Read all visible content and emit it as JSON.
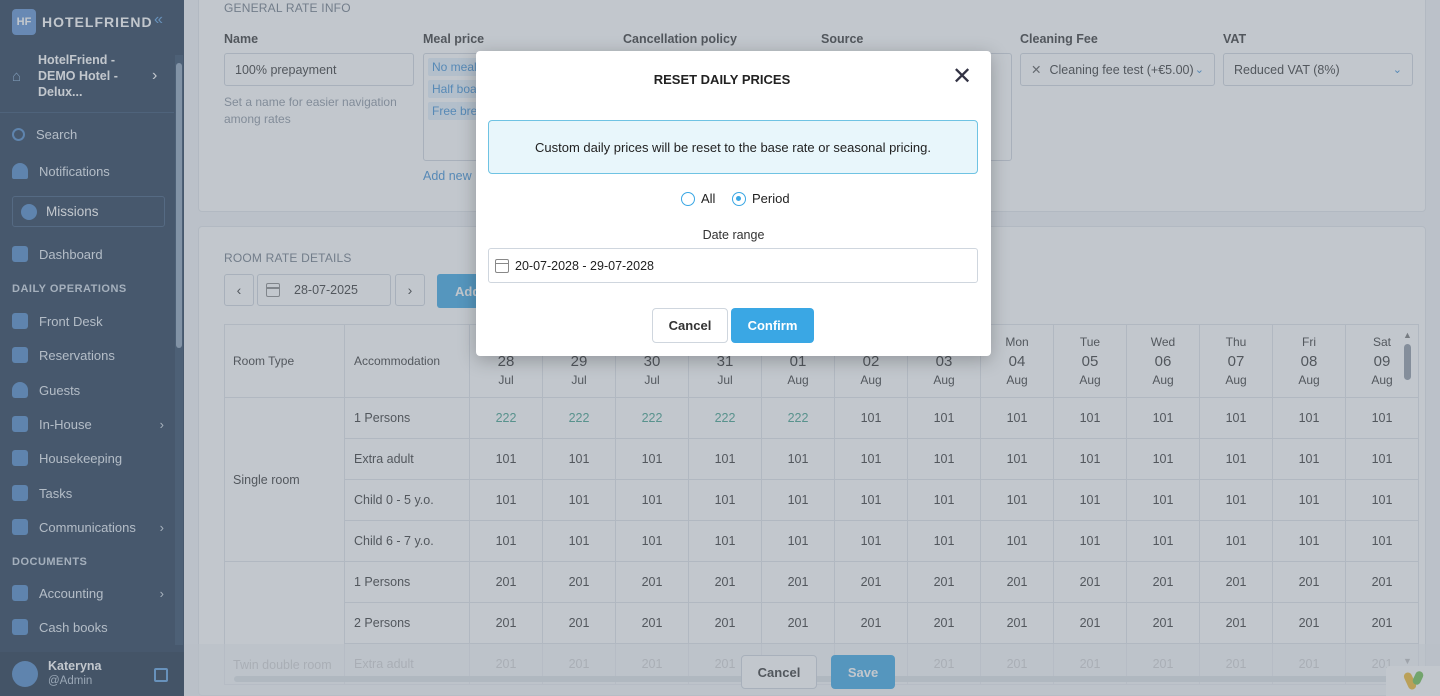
{
  "app": {
    "brand": "HOTELFRIEND",
    "logo_mark": "HF"
  },
  "sidebar": {
    "hotel_name": "HotelFriend - DEMO Hotel - Delux...",
    "search": "Search",
    "notifications": "Notifications",
    "missions": "Missions",
    "dashboard": "Dashboard",
    "section_daily": "DAILY OPERATIONS",
    "front_desk": "Front Desk",
    "reservations": "Reservations",
    "guests": "Guests",
    "in_house": "In-House",
    "housekeeping": "Housekeeping",
    "tasks": "Tasks",
    "communications": "Communications",
    "section_documents": "DOCUMENTS",
    "accounting": "Accounting",
    "cash_books": "Cash books",
    "user_name": "Kateryna",
    "user_role": "@Admin"
  },
  "general": {
    "title": "GENERAL RATE INFO",
    "name_label": "Name",
    "name_value": "100% prepayment",
    "name_hint": "Set a name for easier navigation among rates",
    "meal_label": "Meal price",
    "meal_tags": [
      "No meal",
      "Half boa",
      "Free bre"
    ],
    "add_new": "Add new",
    "cancellation_label": "Cancellation policy",
    "source_label": "Source",
    "cleaning_label": "Cleaning Fee",
    "cleaning_value": "Cleaning fee test (+€5.00)",
    "vat_label": "VAT",
    "vat_value": "Reduced VAT (8%)"
  },
  "room_rates": {
    "title": "ROOM RATE DETAILS",
    "date": "28-07-2025",
    "add_label": "Add",
    "col_room_type": "Room Type",
    "col_accommodation": "Accommodation",
    "days": [
      {
        "dow": "",
        "day": "28",
        "mon": "Jul"
      },
      {
        "dow": "",
        "day": "29",
        "mon": "Jul"
      },
      {
        "dow": "",
        "day": "30",
        "mon": "Jul"
      },
      {
        "dow": "",
        "day": "31",
        "mon": "Jul"
      },
      {
        "dow": "",
        "day": "01",
        "mon": "Aug"
      },
      {
        "dow": "",
        "day": "02",
        "mon": "Aug"
      },
      {
        "dow": "",
        "day": "03",
        "mon": "Aug"
      },
      {
        "dow": "Mon",
        "day": "04",
        "mon": "Aug"
      },
      {
        "dow": "Tue",
        "day": "05",
        "mon": "Aug"
      },
      {
        "dow": "Wed",
        "day": "06",
        "mon": "Aug"
      },
      {
        "dow": "Thu",
        "day": "07",
        "mon": "Aug"
      },
      {
        "dow": "Fri",
        "day": "08",
        "mon": "Aug"
      },
      {
        "dow": "Sat",
        "day": "09",
        "mon": "Aug"
      }
    ],
    "rows": [
      {
        "room": "Single room",
        "acc": "1 Persons",
        "values": [
          "222",
          "222",
          "222",
          "222",
          "222",
          "101",
          "101",
          "101",
          "101",
          "101",
          "101",
          "101",
          "101"
        ]
      },
      {
        "room": "",
        "acc": "Extra adult",
        "values": [
          "101",
          "101",
          "101",
          "101",
          "101",
          "101",
          "101",
          "101",
          "101",
          "101",
          "101",
          "101",
          "101"
        ]
      },
      {
        "room": "",
        "acc": "Child 0 - 5 y.o.",
        "values": [
          "101",
          "101",
          "101",
          "101",
          "101",
          "101",
          "101",
          "101",
          "101",
          "101",
          "101",
          "101",
          "101"
        ]
      },
      {
        "room": "",
        "acc": "Child 6 - 7 y.o.",
        "values": [
          "101",
          "101",
          "101",
          "101",
          "101",
          "101",
          "101",
          "101",
          "101",
          "101",
          "101",
          "101",
          "101"
        ]
      },
      {
        "room": "Twin double room",
        "acc": "1 Persons",
        "values": [
          "201",
          "201",
          "201",
          "201",
          "201",
          "201",
          "201",
          "201",
          "201",
          "201",
          "201",
          "201",
          "201"
        ]
      },
      {
        "room": "",
        "acc": "2 Persons",
        "values": [
          "201",
          "201",
          "201",
          "201",
          "201",
          "201",
          "201",
          "201",
          "201",
          "201",
          "201",
          "201",
          "201"
        ]
      },
      {
        "room": "",
        "acc": "Extra adult",
        "values": [
          "201",
          "201",
          "201",
          "201",
          "201",
          "201",
          "201",
          "201",
          "201",
          "201",
          "201",
          "201",
          "201"
        ]
      }
    ]
  },
  "footer": {
    "cancel": "Cancel",
    "save": "Save"
  },
  "modal": {
    "title": "RESET DAILY PRICES",
    "info": "Custom daily prices will be reset to the base rate or seasonal pricing.",
    "radio_all": "All",
    "radio_period": "Period",
    "selected": "Period",
    "date_label": "Date range",
    "date_value": "20-07-2028 - 29-07-2028",
    "cancel": "Cancel",
    "confirm": "Confirm"
  },
  "colors": {
    "accent": "#3aa7e4",
    "sidebar": "#1f3550",
    "highlight_value": "#3f9e8a"
  }
}
